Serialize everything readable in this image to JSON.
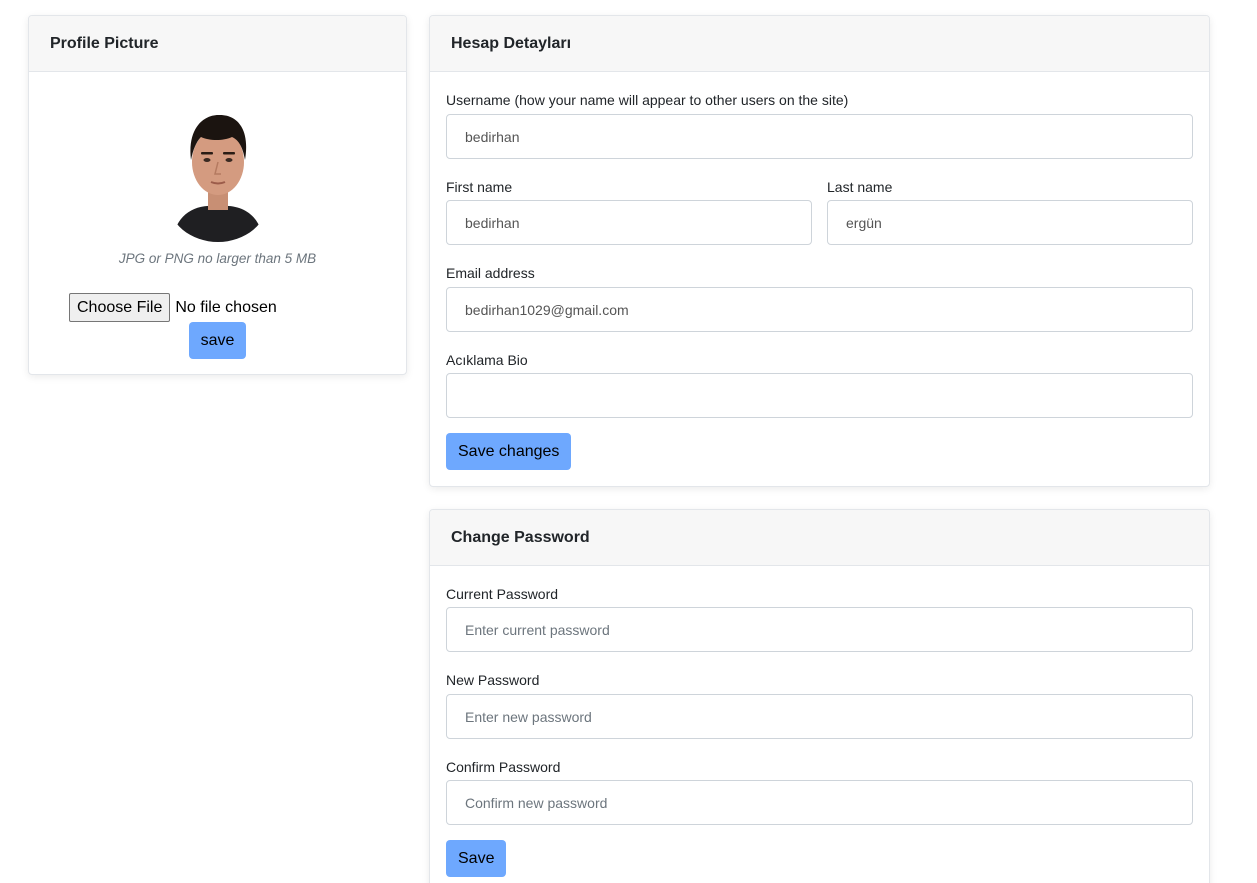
{
  "profile": {
    "title": "Profile Picture",
    "hint": "JPG or PNG no larger than 5 MB",
    "choose_file_label": "Choose File",
    "file_status": "No file chosen",
    "save_label": "save"
  },
  "account": {
    "title": "Hesap Detayları",
    "username_label": "Username (how your name will appear to other users on the site)",
    "username_value": "bedirhan",
    "first_name_label": "First name",
    "first_name_value": "bedirhan",
    "last_name_label": "Last name",
    "last_name_value": "ergün",
    "email_label": "Email address",
    "email_value": "bedirhan1029@gmail.com",
    "bio_label": "Acıklama Bio",
    "bio_value": "",
    "save_label": "Save changes"
  },
  "password": {
    "title": "Change Password",
    "current_label": "Current Password",
    "current_placeholder": "Enter current password",
    "new_label": "New Password",
    "new_placeholder": "Enter new password",
    "confirm_label": "Confirm Password",
    "confirm_placeholder": "Confirm new password",
    "save_label": "Save"
  },
  "colors": {
    "button": "#6ea8fe",
    "header_bg": "#f7f7f7"
  }
}
